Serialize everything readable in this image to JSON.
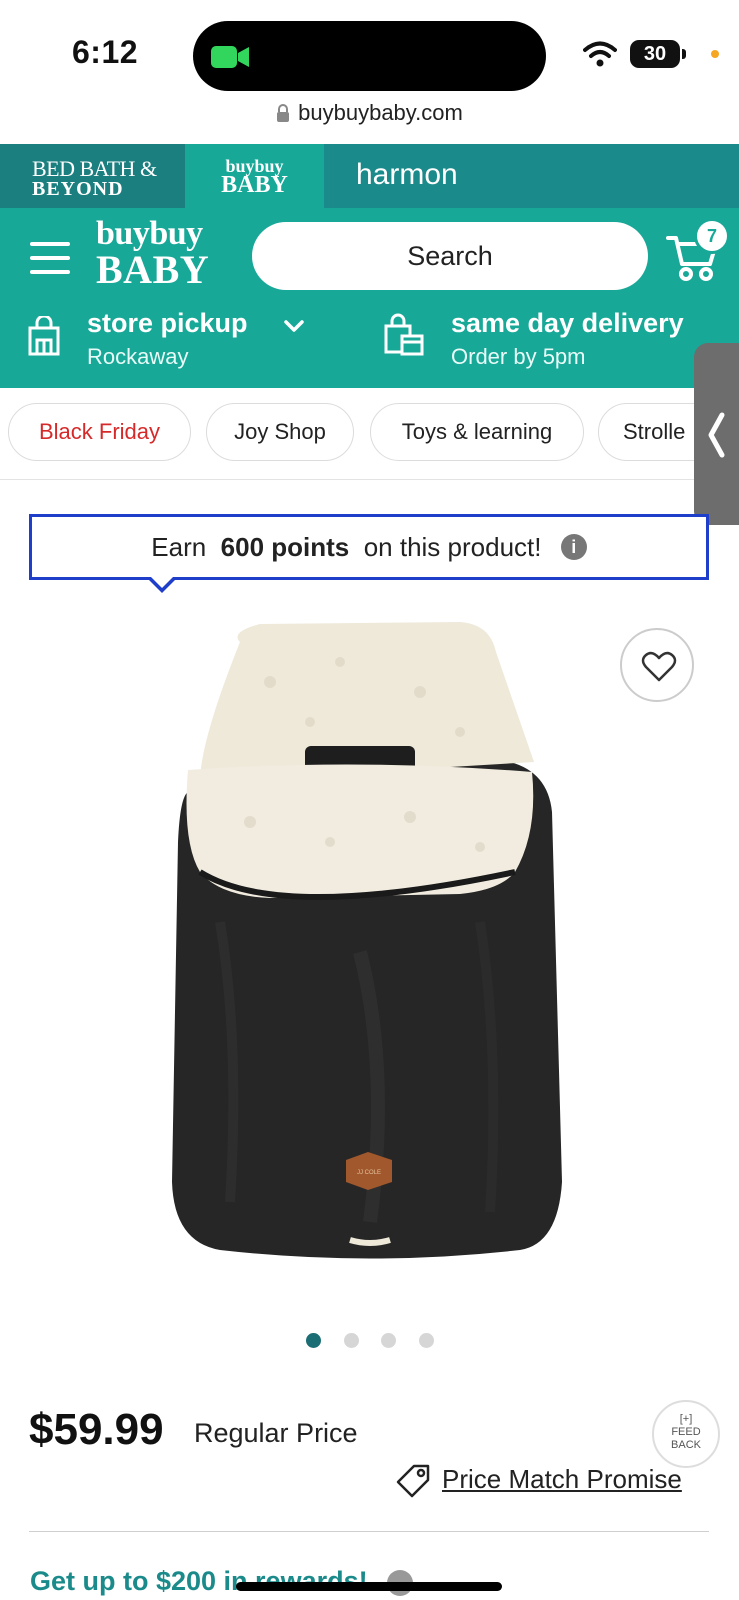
{
  "status_bar": {
    "time": "6:12",
    "battery": "30"
  },
  "url_bar": {
    "url": "buybuybaby.com"
  },
  "brand_bar": {
    "bbb_line1": "BED BATH &",
    "bbb_line2": "BEYOND",
    "baby_line1": "buybuy",
    "baby_line2": "BABY",
    "harmon": "harmon"
  },
  "header": {
    "logo_line1": "buybuy",
    "logo_line2": "BABY",
    "search_placeholder": "Search",
    "cart_count": "7",
    "store_pickup_title": "store pickup",
    "store_pickup_location": "Rockaway",
    "delivery_title": "same day delivery",
    "delivery_sub": "Order by 5pm"
  },
  "categories": [
    {
      "label": "Black Friday",
      "color": "#d62a2a"
    },
    {
      "label": "Joy Shop"
    },
    {
      "label": "Toys & learning"
    },
    {
      "label": "Strolle"
    }
  ],
  "points_banner": {
    "prefix": "Earn",
    "points": "600 points",
    "suffix": "on this product!",
    "info": "i"
  },
  "product": {
    "image_icon": "footmuff-image",
    "patch_text": "JJ COLE",
    "carousel": {
      "total": 4,
      "active": 1
    }
  },
  "pricing": {
    "price": "$59.99",
    "price_label": "Regular Price",
    "price_match": "Price Match Promise",
    "feedback_l1": "[+]",
    "feedback_l2": "FEED",
    "feedback_l3": "BACK",
    "rewards": "Get up to $200 in rewards!"
  },
  "colors": {
    "brand_teal": "#17a898",
    "brand_dark_teal": "#1b7f80",
    "points_border": "#1f3ec9",
    "black_friday": "#d62a2a"
  }
}
